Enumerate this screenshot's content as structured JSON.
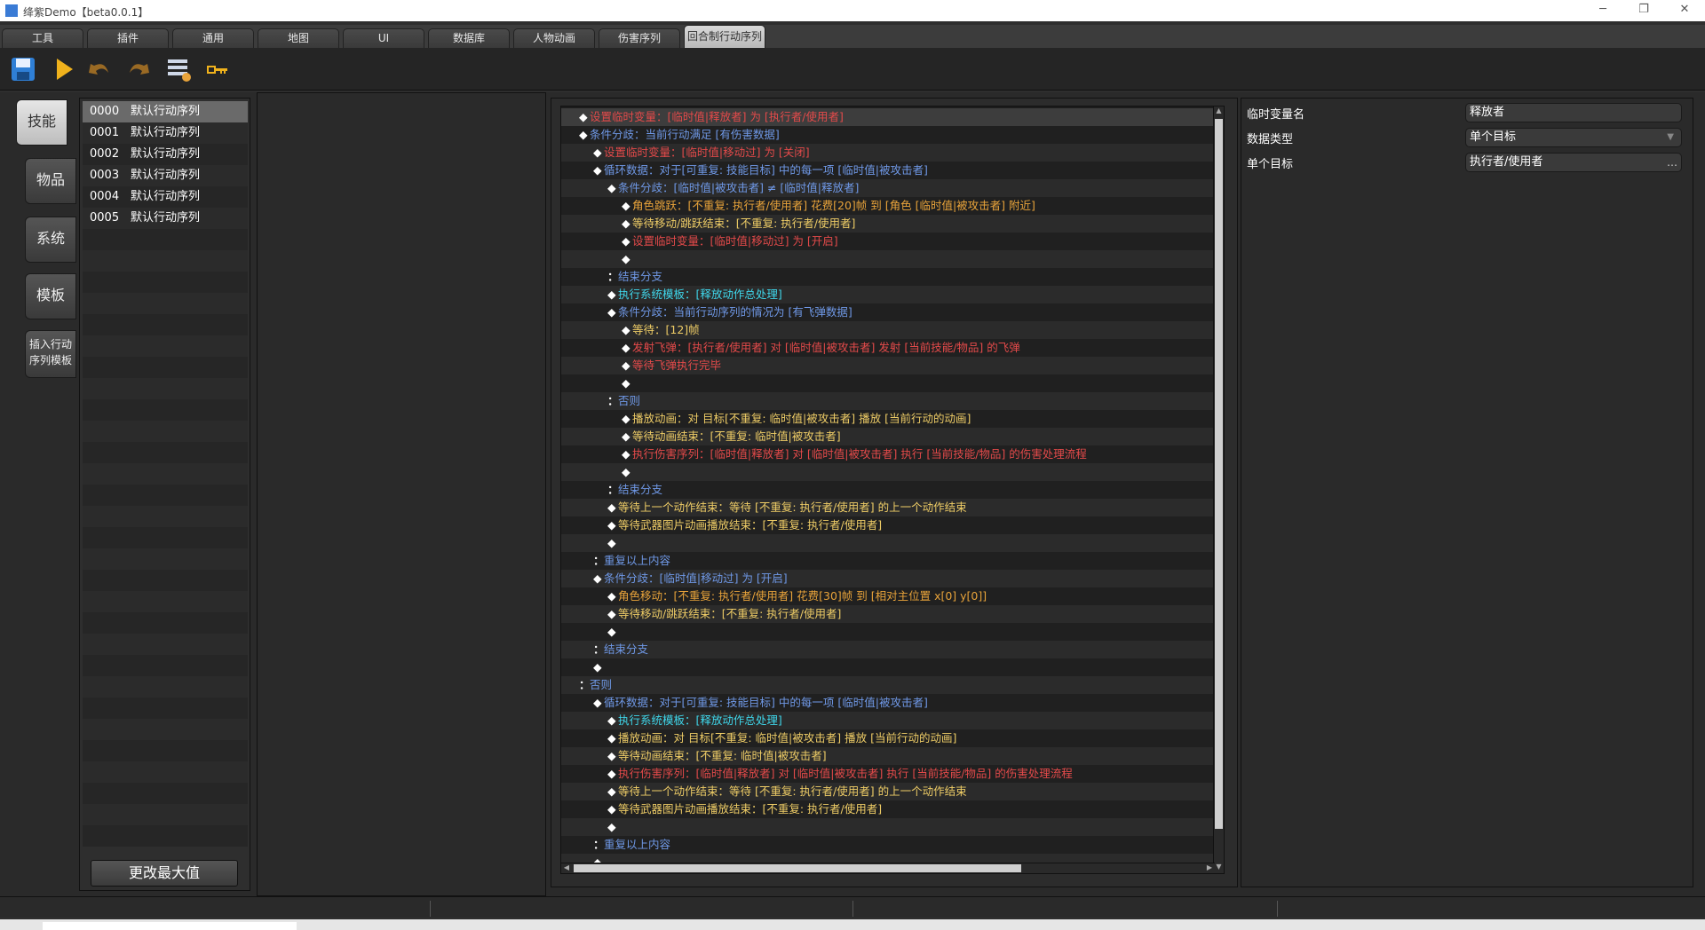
{
  "window": {
    "title": "绛紫Demo【beta0.0.1】"
  },
  "tabs": [
    "工具",
    "插件",
    "通用",
    "地图",
    "UI",
    "数据库",
    "人物动画",
    "伤害序列",
    "回合制行动序列"
  ],
  "active_tab_index": 8,
  "categories": [
    "技能",
    "物品",
    "系统",
    "模板",
    "插入行动\n序列模板"
  ],
  "sequence_list": [
    {
      "id": "0000",
      "name": "默认行动序列"
    },
    {
      "id": "0001",
      "name": "默认行动序列"
    },
    {
      "id": "0002",
      "name": "默认行动序列"
    },
    {
      "id": "0003",
      "name": "默认行动序列"
    },
    {
      "id": "0004",
      "name": "默认行动序列"
    },
    {
      "id": "0005",
      "name": "默认行动序列"
    }
  ],
  "max_button_label": "更改最大值",
  "code_lines": [
    {
      "indent": 1,
      "marker": "◆",
      "text": "设置临时变量：[临时值|释放者] 为 [执行者/使用者]",
      "color": "red"
    },
    {
      "indent": 1,
      "marker": "◆",
      "text": "条件分歧：当前行动满足 [有伤害数据]",
      "color": "blue"
    },
    {
      "indent": 2,
      "marker": "◆",
      "text": "设置临时变量：[临时值|移动过] 为 [关闭]",
      "color": "red"
    },
    {
      "indent": 2,
      "marker": "◆",
      "text": "循环数据：对于[可重复: 技能目标] 中的每一项 [临时值|被攻击者]",
      "color": "blue"
    },
    {
      "indent": 3,
      "marker": "◆",
      "text": "条件分歧：[临时值|被攻击者] ≠ [临时值|释放者]",
      "color": "blue"
    },
    {
      "indent": 4,
      "marker": "◆",
      "text": "角色跳跃：[不重复: 执行者/使用者] 花费[20]帧 到 [角色 [临时值|被攻击者] 附近]",
      "color": "orange"
    },
    {
      "indent": 4,
      "marker": "◆",
      "text": "等待移动/跳跃结束：[不重复: 执行者/使用者]",
      "color": "bright"
    },
    {
      "indent": 4,
      "marker": "◆",
      "text": "设置临时变量：[临时值|移动过] 为 [开启]",
      "color": "red"
    },
    {
      "indent": 4,
      "marker": "◆",
      "text": "",
      "color": "white"
    },
    {
      "indent": 3,
      "marker": "：",
      "text": "结束分支",
      "color": "blue"
    },
    {
      "indent": 3,
      "marker": "◆",
      "text": "执行系统模板：[释放动作总处理]",
      "color": "teal"
    },
    {
      "indent": 3,
      "marker": "◆",
      "text": "条件分歧：当前行动序列的情况为 [有飞弹数据]",
      "color": "blue"
    },
    {
      "indent": 4,
      "marker": "◆",
      "text": "等待：[12]帧",
      "color": "bright"
    },
    {
      "indent": 4,
      "marker": "◆",
      "text": "发射飞弹：[执行者/使用者] 对 [临时值|被攻击者] 发射 [当前技能/物品] 的飞弹",
      "color": "red"
    },
    {
      "indent": 4,
      "marker": "◆",
      "text": "等待飞弹执行完毕",
      "color": "red"
    },
    {
      "indent": 4,
      "marker": "◆",
      "text": "",
      "color": "white"
    },
    {
      "indent": 3,
      "marker": "：",
      "text": "否则",
      "color": "blue"
    },
    {
      "indent": 4,
      "marker": "◆",
      "text": "播放动画：对 目标[不重复: 临时值|被攻击者] 播放 [当前行动的动画]",
      "color": "bright"
    },
    {
      "indent": 4,
      "marker": "◆",
      "text": "等待动画结束：[不重复: 临时值|被攻击者]",
      "color": "bright"
    },
    {
      "indent": 4,
      "marker": "◆",
      "text": "执行伤害序列：[临时值|释放者] 对 [临时值|被攻击者] 执行 [当前技能/物品] 的伤害处理流程",
      "color": "red"
    },
    {
      "indent": 4,
      "marker": "◆",
      "text": "",
      "color": "white"
    },
    {
      "indent": 3,
      "marker": "：",
      "text": "结束分支",
      "color": "blue"
    },
    {
      "indent": 3,
      "marker": "◆",
      "text": "等待上一个动作结束：等待 [不重复: 执行者/使用者] 的上一个动作结束",
      "color": "bright"
    },
    {
      "indent": 3,
      "marker": "◆",
      "text": "等待武器图片动画播放结束：[不重复: 执行者/使用者]",
      "color": "bright"
    },
    {
      "indent": 3,
      "marker": "◆",
      "text": "",
      "color": "white"
    },
    {
      "indent": 2,
      "marker": "：",
      "text": "重复以上内容",
      "color": "blue"
    },
    {
      "indent": 2,
      "marker": "◆",
      "text": "条件分歧：[临时值|移动过] 为 [开启]",
      "color": "blue"
    },
    {
      "indent": 3,
      "marker": "◆",
      "text": "角色移动：[不重复: 执行者/使用者] 花费[30]帧 到 [相对主位置 x[0] y[0]]",
      "color": "orange"
    },
    {
      "indent": 3,
      "marker": "◆",
      "text": "等待移动/跳跃结束：[不重复: 执行者/使用者]",
      "color": "bright"
    },
    {
      "indent": 3,
      "marker": "◆",
      "text": "",
      "color": "white"
    },
    {
      "indent": 2,
      "marker": "：",
      "text": "结束分支",
      "color": "blue"
    },
    {
      "indent": 2,
      "marker": "◆",
      "text": "",
      "color": "white"
    },
    {
      "indent": 1,
      "marker": "：",
      "text": "否则",
      "color": "blue"
    },
    {
      "indent": 2,
      "marker": "◆",
      "text": "循环数据：对于[可重复: 技能目标] 中的每一项 [临时值|被攻击者]",
      "color": "blue"
    },
    {
      "indent": 3,
      "marker": "◆",
      "text": "执行系统模板：[释放动作总处理]",
      "color": "teal"
    },
    {
      "indent": 3,
      "marker": "◆",
      "text": "播放动画：对 目标[不重复: 临时值|被攻击者] 播放 [当前行动的动画]",
      "color": "bright"
    },
    {
      "indent": 3,
      "marker": "◆",
      "text": "等待动画结束：[不重复: 临时值|被攻击者]",
      "color": "bright"
    },
    {
      "indent": 3,
      "marker": "◆",
      "text": "执行伤害序列：[临时值|释放者] 对 [临时值|被攻击者] 执行 [当前技能/物品] 的伤害处理流程",
      "color": "red"
    },
    {
      "indent": 3,
      "marker": "◆",
      "text": "等待上一个动作结束：等待 [不重复: 执行者/使用者] 的上一个动作结束",
      "color": "bright"
    },
    {
      "indent": 3,
      "marker": "◆",
      "text": "等待武器图片动画播放结束：[不重复: 执行者/使用者]",
      "color": "bright"
    },
    {
      "indent": 3,
      "marker": "◆",
      "text": "",
      "color": "white"
    },
    {
      "indent": 2,
      "marker": "：",
      "text": "重复以上内容",
      "color": "blue"
    },
    {
      "indent": 2,
      "marker": "◆",
      "text": "",
      "color": "white"
    }
  ],
  "properties": [
    {
      "label": "临时变量名",
      "value": "释放者",
      "kind": "text"
    },
    {
      "label": "数据类型",
      "value": "单个目标",
      "kind": "dropdown"
    },
    {
      "label": "单个目标",
      "value": "执行者/使用者",
      "kind": "picker"
    }
  ],
  "toolbar": {
    "icons": [
      "save-icon",
      "run-icon",
      "undo-icon",
      "redo-icon",
      "list-edit-icon",
      "key-icon"
    ]
  },
  "colors": {
    "red": "#e34a4a",
    "orange": "#e8a33a",
    "blue": "#6f98e6",
    "teal": "#3fd6ea",
    "bright": "#eecc66",
    "white": "#ffffff"
  }
}
